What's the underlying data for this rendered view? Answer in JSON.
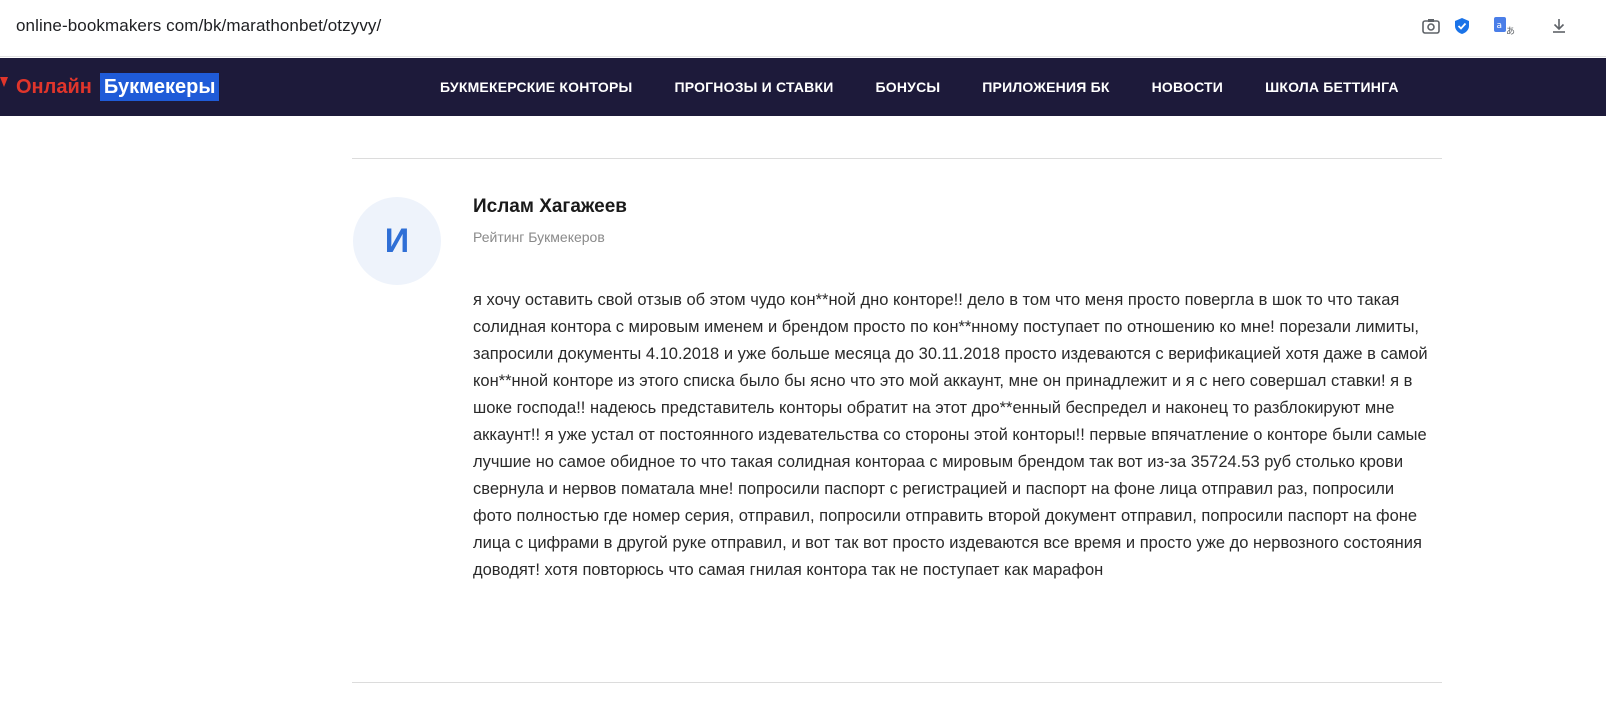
{
  "browser": {
    "url": "online-bookmakers com/bk/marathonbet/otzyvy/",
    "icons": [
      "screenshot-icon",
      "shield-check-icon",
      "translate-icon",
      "download-icon"
    ]
  },
  "site": {
    "logo": {
      "part1": "Онлайн",
      "part2": "Букмекеры"
    },
    "menu": [
      "БУКМЕКЕРСКИЕ КОНТОРЫ",
      "ПРОГНОЗЫ И СТАВКИ",
      "БОНУСЫ",
      "ПРИЛОЖЕНИЯ БК",
      "НОВОСТИ",
      "ШКОЛА БЕТТИНГА"
    ],
    "colors": {
      "nav_bg": "#1d1a3a",
      "logo_red": "#e0352b",
      "logo_blue": "#1f5bd8",
      "avatar_letter": "#2f6fd6"
    }
  },
  "review": {
    "avatar_letter": "И",
    "author": "Ислам Хагажеев",
    "source": "Рейтинг Букмекеров",
    "text": "я хочу оставить свой отзыв об этом чудо кон**ной дно конторе!! дело в том что меня просто повергла в шок то что такая солидная контора с мировым именем и брендом просто по кон**нному поступает по отношению ко мне! порезали лимиты, запросили документы 4.10.2018 и уже больше месяца до 30.11.2018 просто издеваются с верификацией хотя даже в самой кон**нной конторе из этого списка было бы ясно что это мой аккаунт, мне он принадлежит и я с него совершал ставки! я в шоке господа!! надеюсь представитель конторы обратит на этот дро**енный беспредел и наконец то разблокируют мне аккаунт!! я уже устал от постоянного издевательства со стороны этой конторы!! первые впячатление о конторе были самые лучшие но самое обидное то что такая солидная контораа с мировым брендом так вот из-за 35724.53 руб столько крови свернула и нервов поматала мне! попросили паспорт с регистрацией и паспорт на фоне лица отправил раз, попросили фото полностью где номер серия, отправил, попросили отправить второй документ отправил, попросили паспорт на фоне лица с цифрами в другой руке отправил, и вот так вот просто издеваются все время и просто уже до нервозного состояния доводят! хотя повторюсь что самая гнилая контора так не поступает как марафон"
  }
}
